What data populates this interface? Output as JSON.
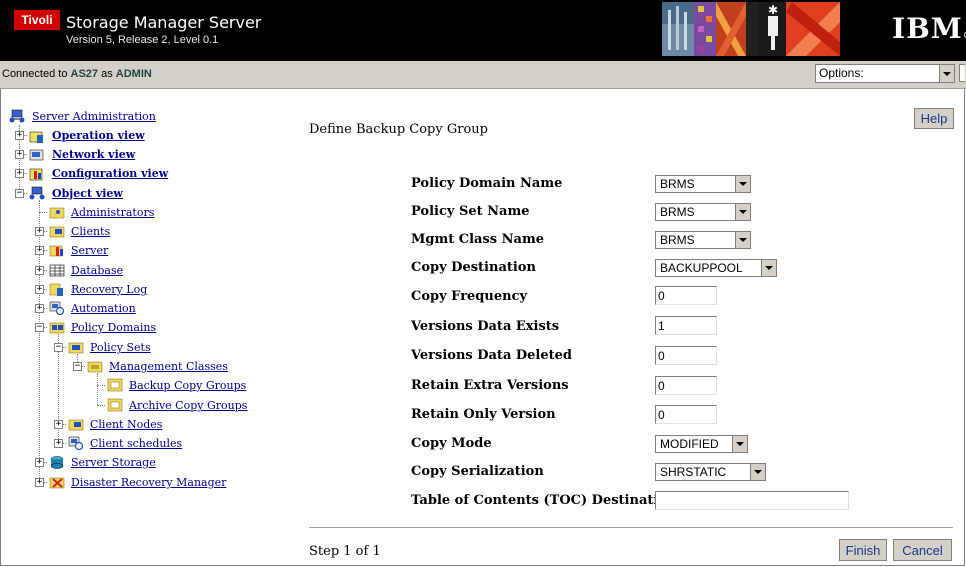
{
  "header": {
    "logo_text": "Tivoli",
    "title": "Storage Manager Server",
    "version": "Version 5, Release 2, Level 0.1",
    "ibm_logo": "IBM",
    "ibm_mark": "®"
  },
  "status": {
    "prefix": "Connected to",
    "server": "AS27",
    "as_word": "as",
    "user": "ADMIN"
  },
  "options": {
    "value": "Options:"
  },
  "tree": {
    "root": "Server Administration",
    "items": {
      "operation_view": "Operation view",
      "network_view": "Network view",
      "configuration_view": "Configuration view",
      "object_view": "Object view",
      "administrators": "Administrators",
      "clients": "Clients",
      "server": "Server",
      "database": "Database",
      "recovery_log": "Recovery Log",
      "automation": "Automation",
      "policy_domains": "Policy Domains",
      "policy_sets": "Policy Sets",
      "management_classes": "Management Classes",
      "backup_copy_groups": "Backup Copy Groups",
      "archive_copy_groups": "Archive Copy Groups",
      "client_nodes": "Client Nodes",
      "client_schedules": "Client schedules",
      "server_storage": "Server Storage",
      "disaster_recovery_manager": "Disaster Recovery Manager"
    },
    "expander_plus": "+",
    "expander_minus": "−"
  },
  "form": {
    "title": "Define Backup Copy Group",
    "help": "Help",
    "fields": {
      "policy_domain_name": {
        "label": "Policy Domain Name",
        "value": "BRMS"
      },
      "policy_set_name": {
        "label": "Policy Set Name",
        "value": "BRMS"
      },
      "mgmt_class_name": {
        "label": "Mgmt Class Name",
        "value": "BRMS"
      },
      "copy_destination": {
        "label": "Copy Destination",
        "value": "BACKUPPOOL"
      },
      "copy_frequency": {
        "label": "Copy Frequency",
        "value": "0"
      },
      "versions_data_exists": {
        "label": "Versions Data Exists",
        "value": "1"
      },
      "versions_data_deleted": {
        "label": "Versions Data Deleted",
        "value": "0"
      },
      "retain_extra_versions": {
        "label": "Retain Extra Versions",
        "value": "0"
      },
      "retain_only_version": {
        "label": "Retain Only Version",
        "value": "0"
      },
      "copy_mode": {
        "label": "Copy Mode",
        "value": "MODIFIED"
      },
      "copy_serialization": {
        "label": "Copy Serialization",
        "value": "SHRSTATIC"
      },
      "toc_destination": {
        "label": "Table of Contents (TOC) Destination",
        "value": ""
      }
    }
  },
  "footer": {
    "step": "Step 1 of 1",
    "finish": "Finish",
    "cancel": "Cancel"
  },
  "colors": {
    "link": "#00008b",
    "header_bg": "#000000",
    "chrome_bg": "#d4d0c8",
    "tivoli_red": "#d10000",
    "button_text": "#1a3a8c"
  }
}
